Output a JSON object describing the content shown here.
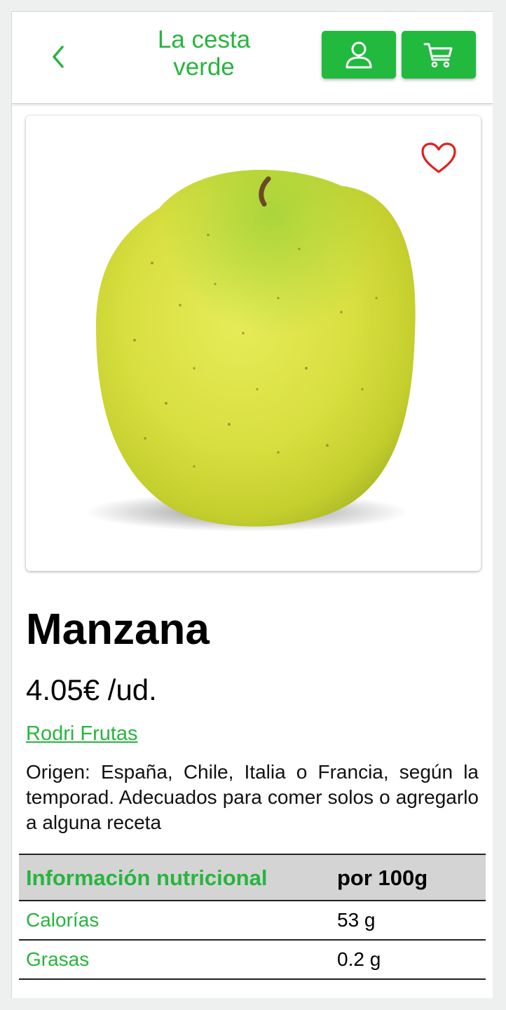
{
  "header": {
    "title": "La cesta verde",
    "accent_color": "#22b93f",
    "icons": [
      "chevron-left-icon",
      "user-icon",
      "cart-icon"
    ]
  },
  "product": {
    "name": "Manzana",
    "price": "4.05€ /ud.",
    "seller": "Rodri Frutas",
    "description": "Origen: España, Chile, Italia o Francia, según la temporad. Adecuados para comer solos o agregarlo a alguna receta",
    "favorite_icon_color": "#e0201c"
  },
  "nutrition": {
    "header_label": "Información nutricional",
    "header_unit": "por 100g",
    "rows": [
      {
        "label": "Calorías",
        "value": "53 g"
      },
      {
        "label": "Grasas",
        "value": "0.2 g"
      }
    ]
  }
}
